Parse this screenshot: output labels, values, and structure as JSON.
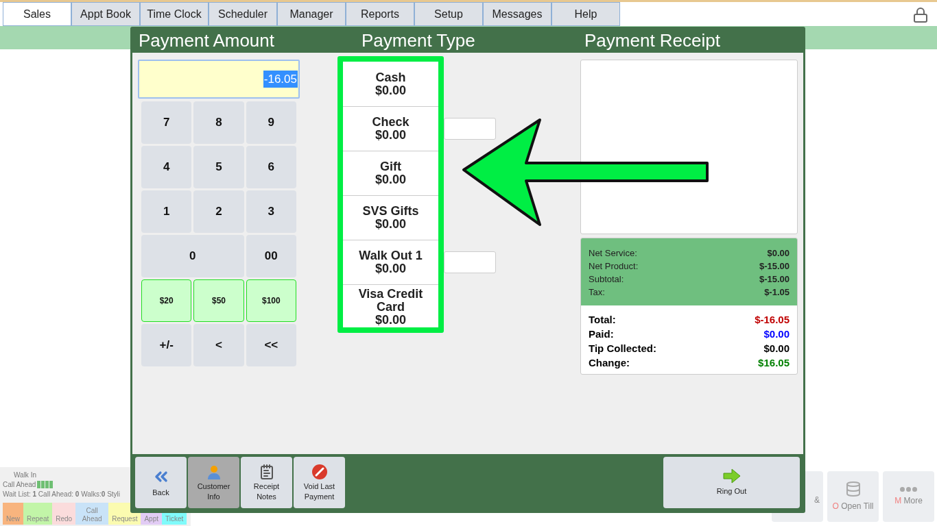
{
  "tabs": [
    {
      "label": "Sales",
      "selected": true
    },
    {
      "label": "Appt Book",
      "selected": false
    },
    {
      "label": "Time Clock",
      "selected": false
    },
    {
      "label": "Scheduler",
      "selected": false
    },
    {
      "label": "Manager",
      "selected": false
    },
    {
      "label": "Reports",
      "selected": false
    },
    {
      "label": "Setup",
      "selected": false
    },
    {
      "label": "Messages",
      "selected": false
    },
    {
      "label": "Help",
      "selected": false
    }
  ],
  "queue": {
    "walk_in_label": "Walk In",
    "call_ahead_label": "Call Ahead",
    "stats": "Wait List: **1**   Call Ahead: **0**   Walks:**0**   Styli",
    "types": [
      {
        "label": "New",
        "color": "#f8b47e"
      },
      {
        "label": "Repeat",
        "color": "#c2f5a8"
      },
      {
        "label": "Redo",
        "color": "#fbdcdc"
      },
      {
        "label": "Call Ahead",
        "color": "#c9e3f8"
      },
      {
        "label": "Request",
        "color": "#fbfbb0"
      },
      {
        "label": "Appt",
        "color": "#e2ccf5"
      },
      {
        "label": "Ticket",
        "color": "#80fbfb"
      }
    ]
  },
  "bottom_buttons": [
    {
      "label": "&"
    },
    {
      "hotkey": "O",
      "label": "Open Till"
    },
    {
      "hotkey": "M",
      "label": "More"
    }
  ],
  "dialog": {
    "titles": [
      "Payment Amount",
      "Payment Type",
      "Payment Receipt"
    ],
    "amount": "-16.05",
    "keypad": [
      {
        "label": "7",
        "kind": "digit"
      },
      {
        "label": "8",
        "kind": "digit"
      },
      {
        "label": "9",
        "kind": "digit"
      },
      {
        "label": "4",
        "kind": "digit"
      },
      {
        "label": "5",
        "kind": "digit"
      },
      {
        "label": "6",
        "kind": "digit"
      },
      {
        "label": "1",
        "kind": "digit"
      },
      {
        "label": "2",
        "kind": "digit"
      },
      {
        "label": "3",
        "kind": "digit"
      },
      {
        "label": "0",
        "kind": "wide"
      },
      {
        "label": "00",
        "kind": "digit"
      },
      {
        "label": "$20",
        "kind": "cash"
      },
      {
        "label": "$50",
        "kind": "cash"
      },
      {
        "label": "$100",
        "kind": "cash"
      },
      {
        "label": "+/-",
        "kind": "digit"
      },
      {
        "label": "<",
        "kind": "digit"
      },
      {
        "label": "<<",
        "kind": "digit"
      }
    ],
    "payment_types": [
      {
        "name": "Cash",
        "amount": "$0.00",
        "field": false
      },
      {
        "name": "Check",
        "amount": "$0.00",
        "field": true
      },
      {
        "name": "Gift",
        "amount": "$0.00",
        "field": false
      },
      {
        "name": "SVS Gifts",
        "amount": "$0.00",
        "field": false
      },
      {
        "name": "Walk Out 1",
        "amount": "$0.00",
        "field": true
      },
      {
        "name": "Visa Credit Card",
        "amount": "$0.00",
        "field": false
      }
    ],
    "subtotals": [
      {
        "label": "Net Service:",
        "value": "$0.00"
      },
      {
        "label": "Net Product:",
        "value": "$-15.00"
      },
      {
        "label": "Subtotal:",
        "value": "$-15.00"
      },
      {
        "label": "Tax:",
        "value": "$-1.05"
      }
    ],
    "totals": [
      {
        "label": "Total:",
        "value": "$-16.05",
        "color": "#c00000"
      },
      {
        "label": "Paid:",
        "value": "$0.00",
        "color": "#0000ff"
      },
      {
        "label": "Tip Collected:",
        "value": "$0.00",
        "color": "#000000"
      },
      {
        "label": "Change:",
        "value": "$16.05",
        "color": "#008000"
      }
    ],
    "footer_buttons": [
      {
        "label": "Back",
        "kind": "back",
        "selected": false
      },
      {
        "label": "Customer Info",
        "kind": "customer",
        "selected": true
      },
      {
        "label": "Receipt Notes",
        "kind": "notes",
        "selected": false
      },
      {
        "label": "Void Last Payment",
        "kind": "void",
        "selected": false
      }
    ],
    "ring_out": "Ring Out"
  }
}
